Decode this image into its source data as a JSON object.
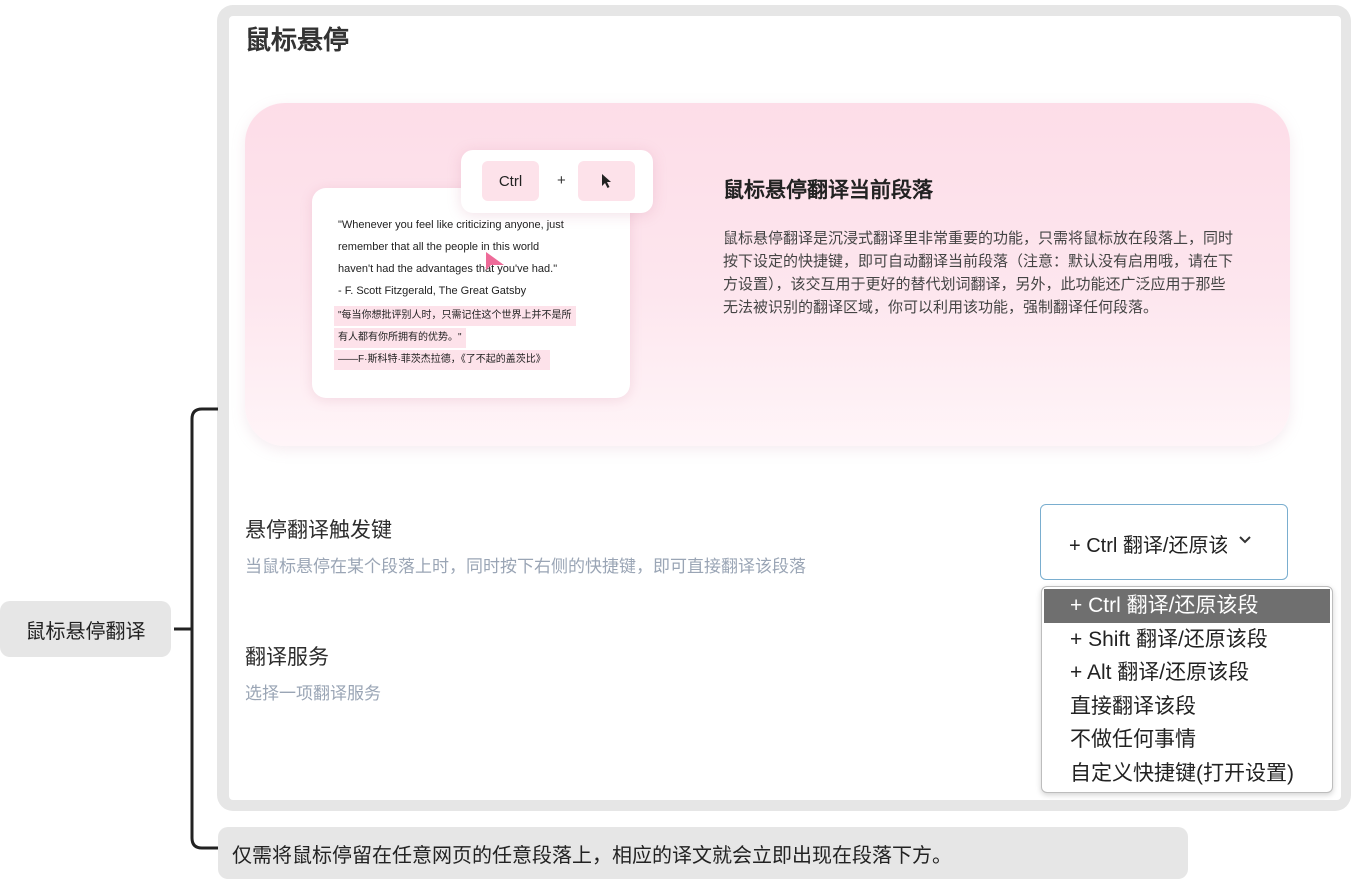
{
  "section": {
    "title": "鼠标悬停"
  },
  "hero": {
    "title": "鼠标悬停翻译当前段落",
    "description": "鼠标悬停翻译是沉浸式翻译里非常重要的功能，只需将鼠标放在段落上，同时按下设定的快捷键，即可自动翻译当前段落（注意：默认没有启用哦，请在下方设置），该交互用于更好的替代划词翻译，另外，此功能还广泛应用于那些无法被识别的翻译区域，你可以利用该功能，强制翻译任何段落。",
    "demo": {
      "key_ctrl": "Ctrl",
      "key_plus": "+",
      "quote_lines": [
        "\"Whenever you feel like criticizing anyone, just",
        "remember that all the people in this world",
        "haven't had the advantages that you've had.\"",
        " - F. Scott Fitzgerald, The Great Gatsby"
      ],
      "translation_lines": [
        "\"每当你想批评别人时，只需记住这个世界上并不是所",
        "有人都有你所拥有的优势。\"",
        "——F·斯科特·菲茨杰拉德，《了不起的盖茨比》"
      ]
    }
  },
  "trigger_setting": {
    "label": "悬停翻译触发键",
    "description": "当鼠标悬停在某个段落上时，同时按下右侧的快捷键，即可直接翻译该段落",
    "selected_value": "+ Ctrl 翻译/还原该段",
    "options": [
      "+ Ctrl 翻译/还原该段",
      "+ Shift 翻译/还原该段",
      "+ Alt 翻译/还原该段",
      "直接翻译该段",
      "不做任何事情",
      "自定义快捷键(打开设置)"
    ]
  },
  "service_setting": {
    "label": "翻译服务",
    "description": "选择一项翻译服务"
  },
  "annotations": {
    "side_label": "鼠标悬停翻译",
    "bottom_note": "仅需将鼠标停留在任意网页的任意段落上，相应的译文就会立即出现在段落下方。"
  },
  "colors": {
    "hero_pink": "#fddde8",
    "select_border": "#7aaecf",
    "selected_option_bg": "#6f6f6f",
    "cursor_pink": "#ee6b99"
  },
  "icons": {
    "cursor_key": "mouse-pointer-icon",
    "demo_cursor": "pink-mouse-pointer-icon",
    "dropdown": "chevron-down-icon"
  }
}
